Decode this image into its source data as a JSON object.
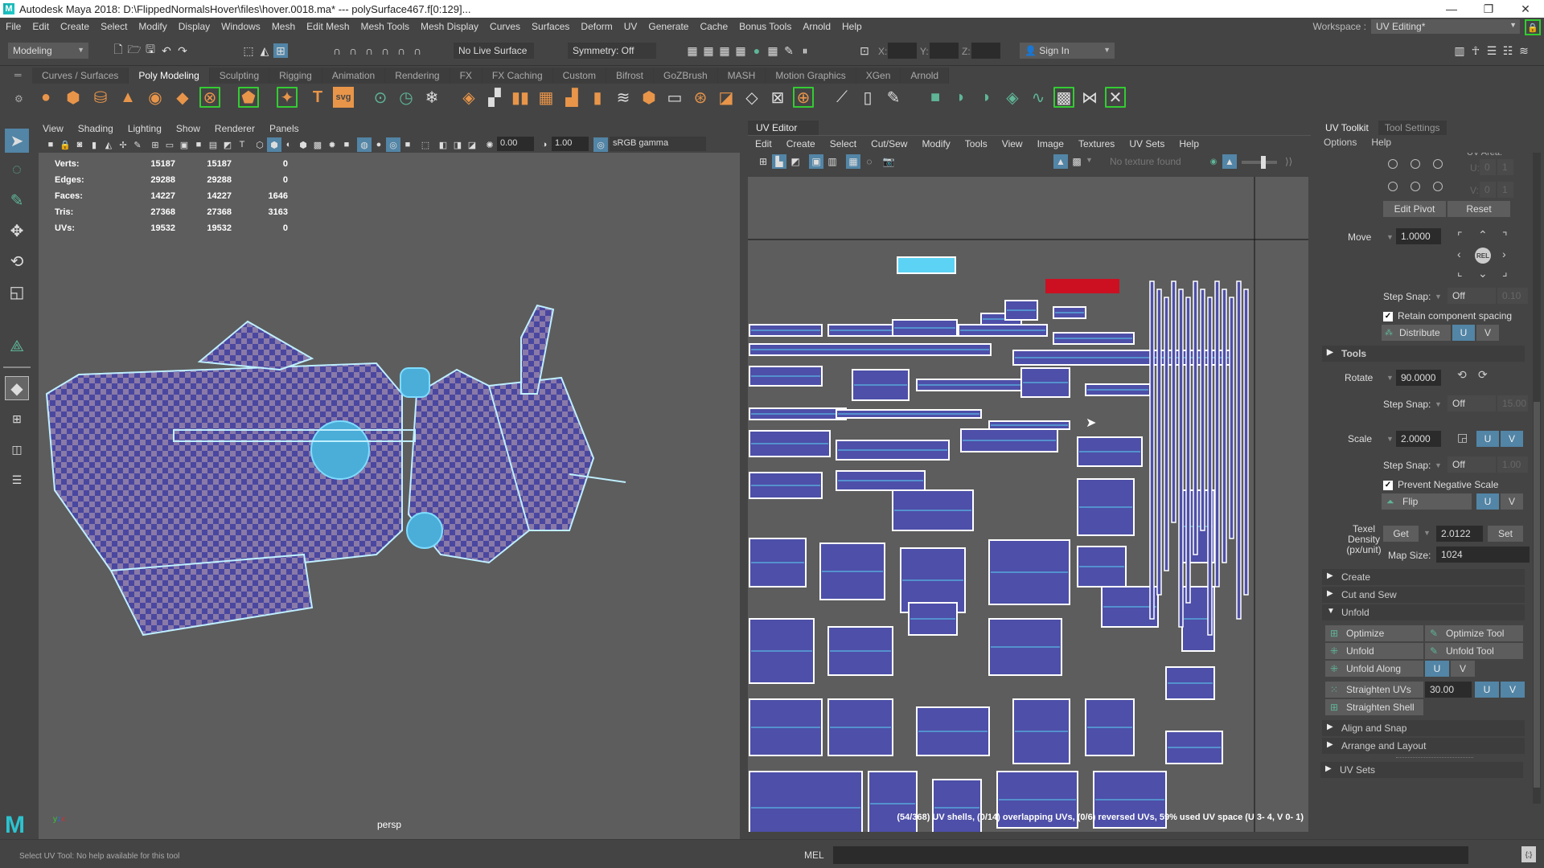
{
  "title": {
    "app": "Autodesk Maya 2018: D:\\FlippedNormalsHover\\files\\hover.0018.ma*   ---   polySurface467.f[0:129]...",
    "minimize": "—",
    "restore": "❐",
    "close": "✕"
  },
  "menubar": {
    "items": [
      "File",
      "Edit",
      "Create",
      "Select",
      "Modify",
      "Display",
      "Windows",
      "Mesh",
      "Edit Mesh",
      "Mesh Tools",
      "Mesh Display",
      "Curves",
      "Surfaces",
      "Deform",
      "UV",
      "Generate",
      "Cache",
      "Bonus Tools",
      "Arnold",
      "Help"
    ]
  },
  "workspace": {
    "label": "Workspace :",
    "value": "UV Editing*"
  },
  "statusline": {
    "mode": "Modeling",
    "live_surface": "No Live Surface",
    "symmetry": "Symmetry: Off",
    "x_label": "X:",
    "y_label": "Y:",
    "z_label": "Z:",
    "sign_in": "Sign In"
  },
  "shelf": {
    "tabs": [
      "Curves / Surfaces",
      "Poly Modeling",
      "Sculpting",
      "Rigging",
      "Animation",
      "Rendering",
      "FX",
      "FX Caching",
      "Custom",
      "Bifrost",
      "GoZBrush",
      "MASH",
      "Motion Graphics",
      "XGen",
      "Arnold"
    ],
    "active_tab": "Poly Modeling",
    "icons": [
      "sphere",
      "cube",
      "cylinder",
      "cone",
      "torus",
      "plane",
      "disc",
      "platonic",
      "superellipse",
      "type",
      "svg",
      "sweep-mesh",
      "poly-count",
      "smooth",
      "combine",
      "separate",
      "extract",
      "booleans",
      "mirror",
      "quadrangulate",
      "fill-hole",
      "bevel",
      "bridge",
      "append",
      "extrude",
      "multi-cut",
      "target-weld",
      "connect",
      "insert-loop",
      "auto-unwrap",
      "planar",
      "cylindrical",
      "spherical",
      "camera-based",
      "uv-editor",
      "unfold",
      "cut",
      "sew"
    ]
  },
  "toolbox": {
    "tools": [
      "select-tool",
      "lasso-tool",
      "paint-select-tool",
      "move-tool",
      "rotate-tool",
      "scale-tool",
      "show-manipulator",
      "single-perspective-layout",
      "four-view-layout",
      "two-view-layout",
      "outliner-layout"
    ]
  },
  "viewport": {
    "menu": [
      "View",
      "Shading",
      "Lighting",
      "Show",
      "Renderer",
      "Panels"
    ],
    "exposure": "0.00",
    "gamma": "1.00",
    "color_space": "sRGB gamma",
    "camera": "persp",
    "hud": [
      {
        "label": "Verts:",
        "a": "15187",
        "b": "15187",
        "c": "0"
      },
      {
        "label": "Edges:",
        "a": "29288",
        "b": "29288",
        "c": "0"
      },
      {
        "label": "Faces:",
        "a": "14227",
        "b": "14227",
        "c": "1646"
      },
      {
        "label": "Tris:",
        "a": "27368",
        "b": "27368",
        "c": "3163"
      },
      {
        "label": "UVs:",
        "a": "19532",
        "b": "19532",
        "c": "0"
      }
    ]
  },
  "uv_editor": {
    "tab": "UV Editor",
    "menu": [
      "Edit",
      "Create",
      "Select",
      "Cut/Sew",
      "Modify",
      "Tools",
      "View",
      "Image",
      "Textures",
      "UV Sets",
      "Help"
    ],
    "texture": "No texture found",
    "status": "(54/368) UV shells, (0/14) overlapping UVs, (0/6) reversed UVs, 59% used UV space (U  3- 4, V  0- 1)",
    "colors": {
      "shell_fill": "#4d4fa8",
      "shell_edge": "#5cd3f5",
      "border": "#ffffff",
      "selected": "#cc1022",
      "bg": "#5d5d5d"
    }
  },
  "uv_toolkit": {
    "tabs": [
      "UV Toolkit",
      "Tool Settings"
    ],
    "menu": [
      "Options",
      "Help"
    ],
    "uv_area": "UV Area:",
    "u_label": "U:",
    "v_label": "V:",
    "u_range": [
      "0",
      "1"
    ],
    "v_range": [
      "0",
      "1"
    ],
    "edit_pivot": "Edit Pivot",
    "reset": "Reset",
    "move": {
      "label": "Move",
      "value": "1.0000",
      "rel": "REL",
      "step_label": "Step Snap:",
      "step": "Off",
      "step_value": "0.10"
    },
    "retain_spacing": {
      "label": "Retain component spacing",
      "checked": true
    },
    "distribute": {
      "label": "Distribute",
      "u": "U",
      "v": "V"
    },
    "tools_section": "Tools",
    "rotate": {
      "label": "Rotate",
      "value": "90.0000",
      "step_label": "Step Snap:",
      "step": "Off",
      "step_value": "15.00"
    },
    "scale": {
      "label": "Scale",
      "value": "2.0000",
      "u": "U",
      "v": "V",
      "step_label": "Step Snap:",
      "step": "Off",
      "step_value": "1.00"
    },
    "prevent_negative": {
      "label": "Prevent Negative Scale",
      "checked": true
    },
    "flip": {
      "label": "Flip",
      "u": "U",
      "v": "V"
    },
    "texel": {
      "label1": "Texel",
      "label2": "Density",
      "label3": "(px/unit)",
      "get": "Get",
      "value": "2.0122",
      "set": "Set",
      "map_size_label": "Map Size:",
      "map_size": "1024"
    },
    "sections": {
      "create": "Create",
      "cut_sew": "Cut and Sew",
      "unfold": "Unfold",
      "align": "Align and Snap",
      "arrange": "Arrange and Layout",
      "uv_sets": "UV Sets"
    },
    "unfold": {
      "optimize": "Optimize",
      "optimize_tool": "Optimize Tool",
      "unfold": "Unfold",
      "unfold_tool": "Unfold Tool",
      "unfold_along": "Unfold Along",
      "u": "U",
      "v": "V",
      "straighten_uvs": "Straighten UVs",
      "straighten_value": "30.00",
      "straighten_shell": "Straighten Shell"
    }
  },
  "bottom": {
    "help": "Select UV Tool: No help available for this tool",
    "mel": "MEL"
  }
}
